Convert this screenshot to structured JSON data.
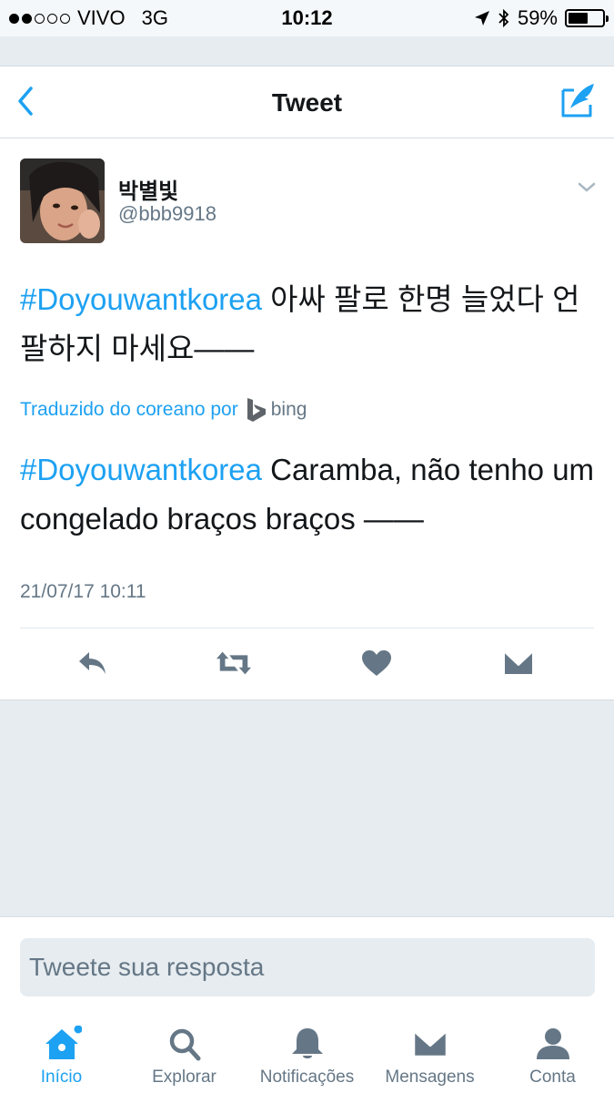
{
  "status_bar": {
    "carrier": "VIVO",
    "network": "3G",
    "time": "10:12",
    "battery": "59%",
    "battery_level": 0.59,
    "signal_bars_filled": 2,
    "signal_bars_total": 5
  },
  "nav": {
    "title": "Tweet",
    "back_icon": "chevron-left-icon",
    "compose_icon": "compose-icon"
  },
  "tweet": {
    "display_name": "박별빛",
    "handle": "@bbb9918",
    "original_hashtag": "#Doyouwantkorea",
    "original_text": " 아싸 팔로 한명 늘었다 언팔하지 마세요——",
    "translated_label": "Traduzido do coreano por",
    "translator": "bing",
    "translation_hashtag": "#Doyouwantkorea",
    "translation_text": " Caramba, não tenho um congelado braços braços ——",
    "timestamp": "21/07/17 10:11",
    "actions": [
      "reply-icon",
      "retweet-icon",
      "like-icon",
      "direct-message-icon"
    ]
  },
  "reply": {
    "placeholder": "Tweete sua resposta"
  },
  "tab_bar": {
    "tabs": [
      {
        "label": "Início",
        "icon": "home-icon",
        "active": true
      },
      {
        "label": "Explorar",
        "icon": "search-icon",
        "active": false
      },
      {
        "label": "Notificações",
        "icon": "bell-icon",
        "active": false
      },
      {
        "label": "Mensagens",
        "icon": "envelope-icon",
        "active": false
      },
      {
        "label": "Conta",
        "icon": "person-icon",
        "active": false
      }
    ]
  },
  "colors": {
    "accent": "#1DA1F2",
    "text": "#14171A",
    "secondary": "#657786",
    "background": "#E6ECF0"
  }
}
